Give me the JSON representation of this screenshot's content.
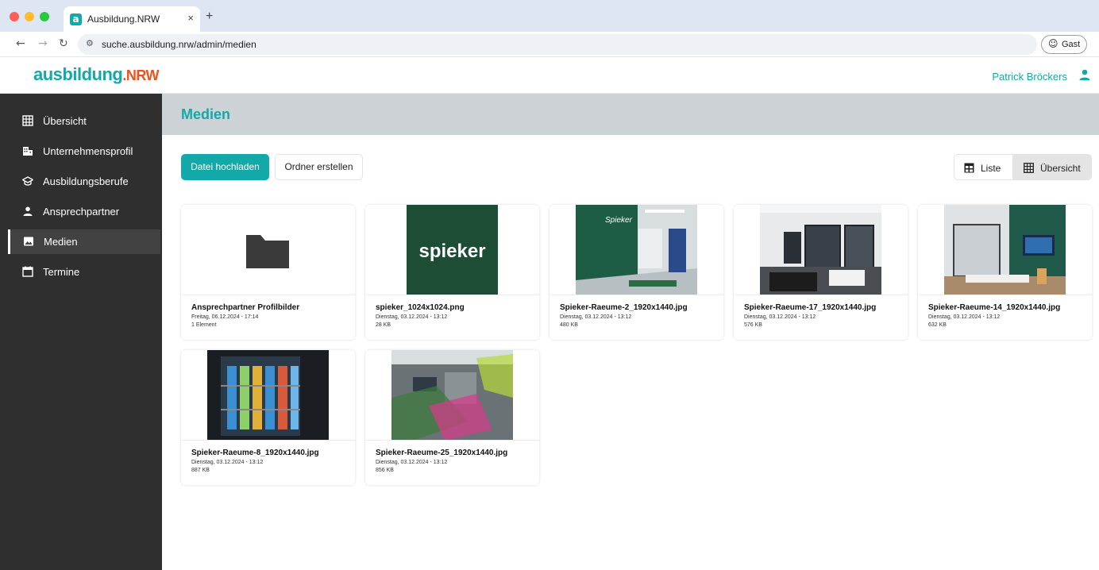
{
  "browser": {
    "tab_title": "Ausbildung.NRW",
    "tab_favicon": "a",
    "tab_close": "×",
    "new_tab": "+",
    "url": "suche.ausbildung.nrw/admin/medien",
    "profile_label": "Gast",
    "traffic_colors": [
      "#ff5f57",
      "#febc2e",
      "#28c840"
    ]
  },
  "header": {
    "logo_main": "ausbildung",
    "logo_suffix": ".NRW",
    "user_name": "Patrick Bröckers",
    "user_icon": "person-icon"
  },
  "sidebar": {
    "items": [
      {
        "label": "Übersicht",
        "icon": "grid-icon"
      },
      {
        "label": "Unternehmensprofil",
        "icon": "building-icon"
      },
      {
        "label": "Ausbildungsberufe",
        "icon": "graduation-cap-icon"
      },
      {
        "label": "Ansprechpartner",
        "icon": "person-icon"
      },
      {
        "label": "Medien",
        "icon": "image-icon",
        "active": true
      },
      {
        "label": "Termine",
        "icon": "calendar-icon"
      }
    ]
  },
  "main": {
    "title": "Medien",
    "upload_button": "Datei hochladen",
    "create_folder_button": "Ordner erstellen",
    "view_list_label": "Liste",
    "view_grid_label": "Übersicht",
    "accent": "#12a9a8"
  },
  "files": [
    {
      "name": "Ansprechpartner Profilbilder",
      "date": "Freitag, 06.12.2024 - 17:14",
      "meta": "1 Element",
      "kind": "folder"
    },
    {
      "name": "spieker_1024x1024.png",
      "date": "Dienstag, 03.12.2024 - 13:12",
      "meta": "28 KB",
      "kind": "logo",
      "logo_text": "spieker"
    },
    {
      "name": "Spieker-Raeume-2_1920x1440.jpg",
      "date": "Dienstag, 03.12.2024 - 13:12",
      "meta": "480 KB",
      "kind": "photo",
      "logo_text": "Spieker"
    },
    {
      "name": "Spieker-Raeume-17_1920x1440.jpg",
      "date": "Dienstag, 03.12.2024 - 13:12",
      "meta": "576 KB",
      "kind": "photo"
    },
    {
      "name": "Spieker-Raeume-14_1920x1440.jpg",
      "date": "Dienstag, 03.12.2024 - 13:12",
      "meta": "632 KB",
      "kind": "photo"
    },
    {
      "name": "Spieker-Raeume-8_1920x1440.jpg",
      "date": "Dienstag, 03.12.2024 - 13:12",
      "meta": "887 KB",
      "kind": "photo"
    },
    {
      "name": "Spieker-Raeume-25_1920x1440.jpg",
      "date": "Dienstag, 03.12.2024 - 13:12",
      "meta": "856 KB",
      "kind": "photo"
    }
  ]
}
